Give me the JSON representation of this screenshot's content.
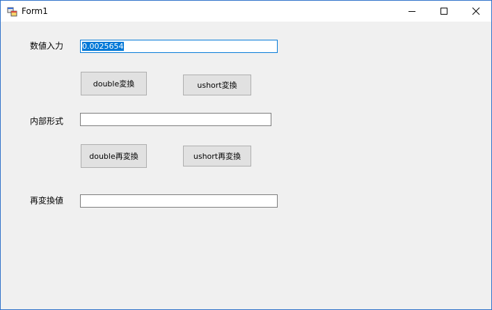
{
  "window": {
    "title": "Form1"
  },
  "fields": {
    "input_label": "数値入力",
    "input_value": "0.0025654",
    "internal_label": "内部形式",
    "internal_value": "",
    "reconverted_label": "再変換値",
    "reconverted_value": ""
  },
  "buttons": {
    "double_convert": "double変換",
    "ushort_convert": "ushort変換",
    "double_reconvert": "double再変換",
    "ushort_reconvert": "ushort再変換"
  },
  "colors": {
    "selection": "#0078d7",
    "window_border": "#2b6fc9"
  }
}
